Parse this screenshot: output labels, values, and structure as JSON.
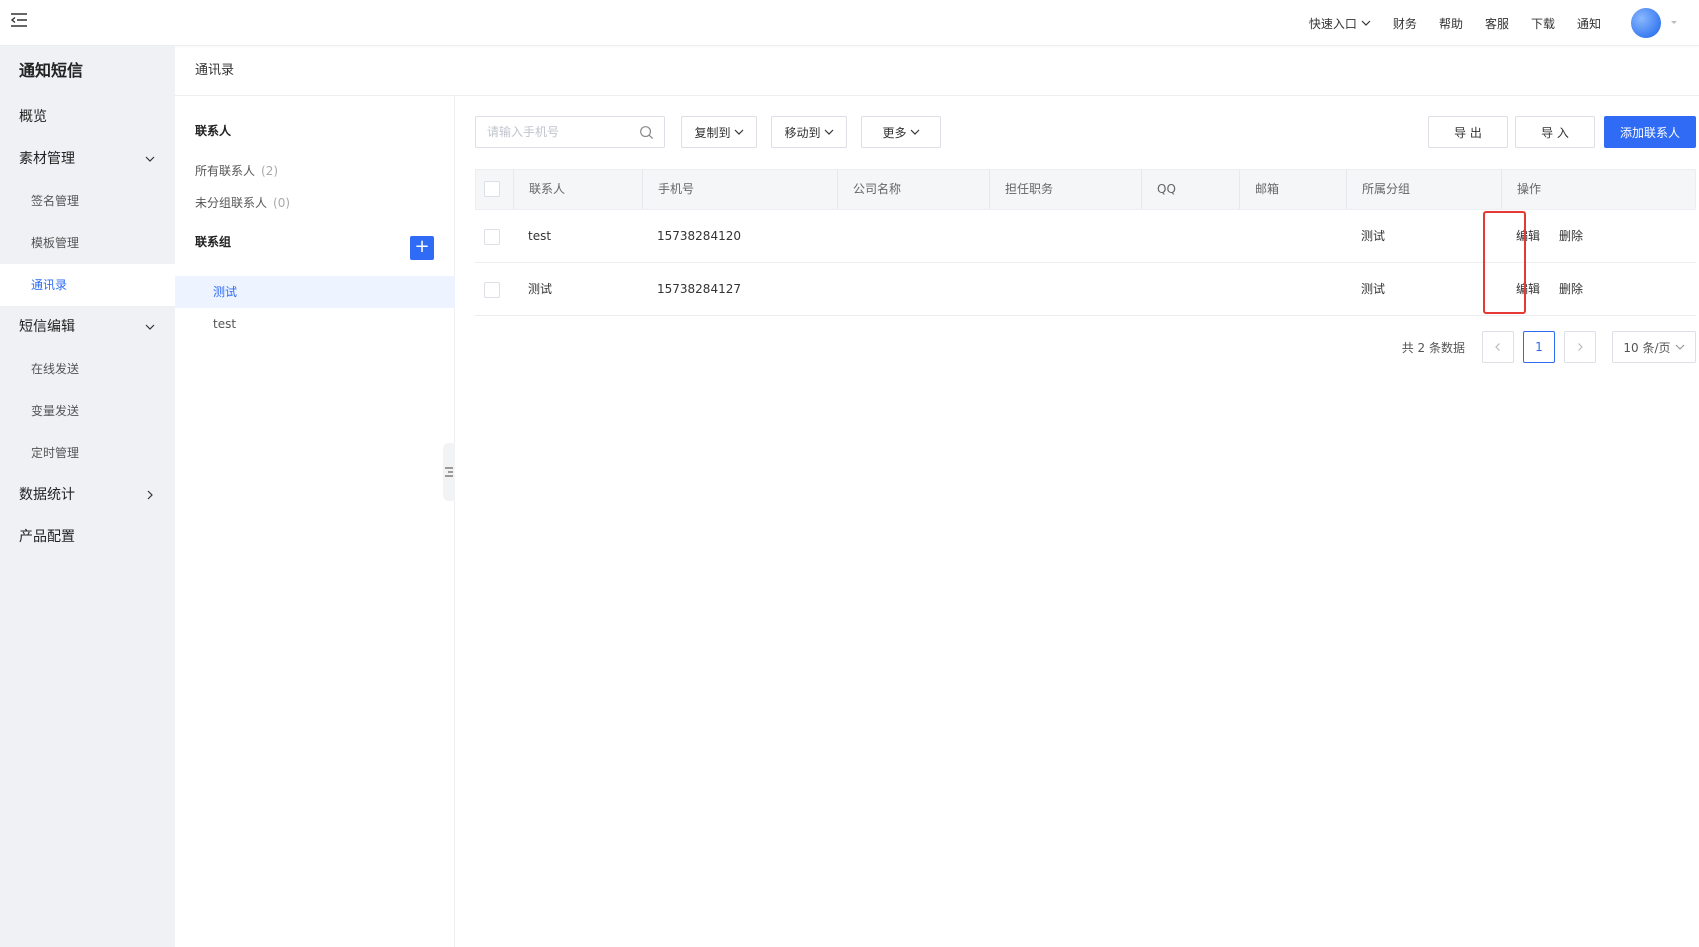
{
  "topbar": {
    "quick_entry": "快速入口",
    "finance": "财务",
    "help": "帮助",
    "service": "客服",
    "download": "下载",
    "notice": "通知"
  },
  "sidebar": {
    "title": "通知短信",
    "overview": "概览",
    "material": "素材管理",
    "signature": "签名管理",
    "template": "模板管理",
    "contacts": "通讯录",
    "sms_edit": "短信编辑",
    "online_send": "在线发送",
    "variable_send": "变量发送",
    "timer_manage": "定时管理",
    "statistics": "数据统计",
    "product_config": "产品配置"
  },
  "breadcrumb": "通讯录",
  "contacts_panel": {
    "contacts_heading": "联系人",
    "all_contacts": "所有联系人",
    "all_count": "(2)",
    "ungrouped": "未分组联系人",
    "ungrouped_count": "(0)",
    "groups_heading": "联系组",
    "add_symbol": "+",
    "groups": [
      "测试",
      "test"
    ]
  },
  "toolbar": {
    "search_placeholder": "请输入手机号",
    "copy_to": "复制到",
    "move_to": "移动到",
    "more": "更多",
    "export": "导 出",
    "import": "导 入",
    "add_contact": "添加联系人"
  },
  "table": {
    "headers": [
      "联系人",
      "手机号",
      "公司名称",
      "担任职务",
      "QQ",
      "邮箱",
      "所属分组",
      "操作"
    ],
    "rows": [
      {
        "name": "test",
        "phone": "15738284120",
        "company": "",
        "position": "",
        "qq": "",
        "email": "",
        "group": "测试"
      },
      {
        "name": "测试",
        "phone": "15738284127",
        "company": "",
        "position": "",
        "qq": "",
        "email": "",
        "group": "测试"
      }
    ],
    "edit_label": "编辑",
    "delete_label": "删除"
  },
  "pagination": {
    "total_text": "共 2 条数据",
    "current_page": "1",
    "page_size": "10 条/页"
  },
  "colors": {
    "primary": "#2f6bf5",
    "highlight": "#e53935",
    "sidebar_bg": "#eff1f4"
  }
}
